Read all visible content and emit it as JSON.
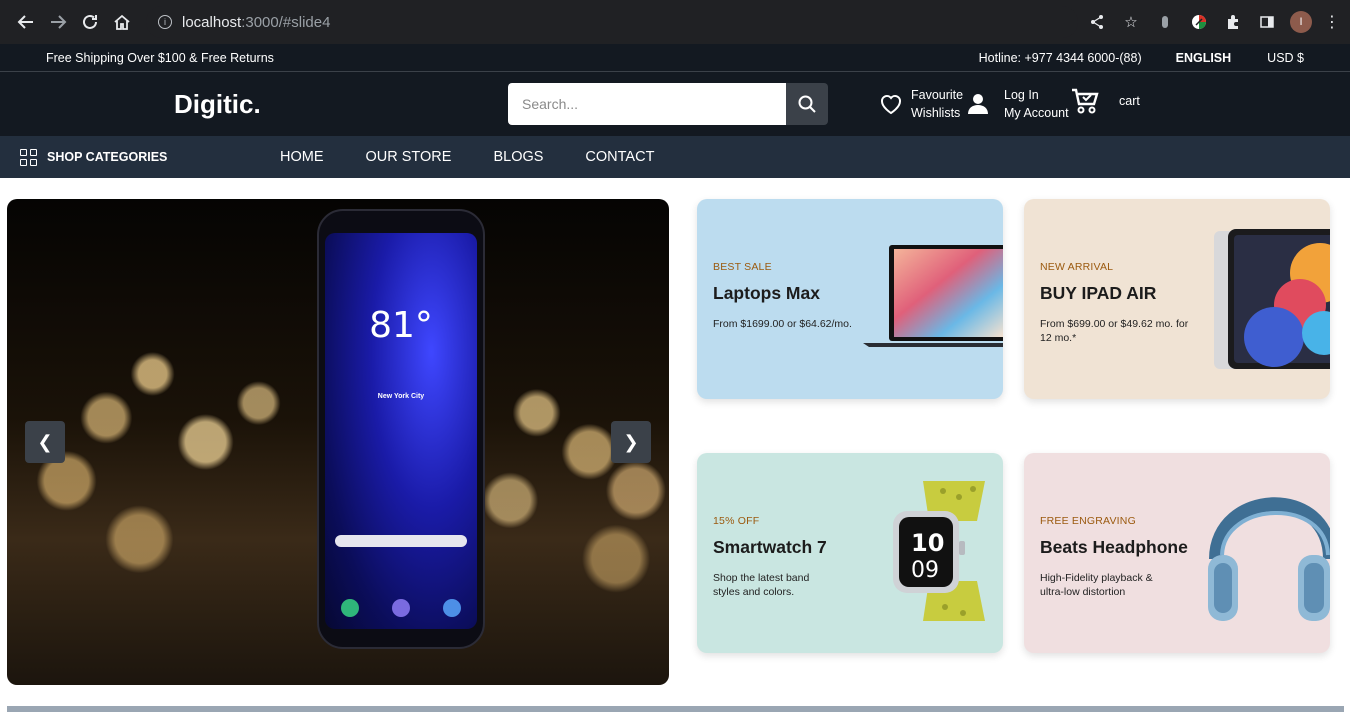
{
  "browser": {
    "url_host": "localhost",
    "url_path": ":3000/#slide4",
    "avatar_letter": "I"
  },
  "top_strip": {
    "shipping": "Free Shipping Over $100 & Free Returns",
    "hotline": "Hotline: +977 4344 6000-(88)",
    "language": "ENGLISH",
    "currency": "USD $"
  },
  "header": {
    "logo": "Digitic.",
    "search_placeholder": "Search...",
    "favourite_line1": "Favourite",
    "favourite_line2": "Wishlists",
    "login_line1": "Log In",
    "login_line2": "My Account",
    "cart_label": "cart"
  },
  "nav": {
    "shop_categories": "SHOP CATEGORIES",
    "items": [
      "HOME",
      "OUR STORE",
      "BLOGS",
      "CONTACT"
    ]
  },
  "hero": {
    "phone_time": "81°",
    "phone_city": "New York City",
    "prev_label": "❮",
    "next_label": "❯"
  },
  "cards": [
    {
      "tag": "BEST SALE",
      "title": "Laptops Max",
      "desc": "From $1699.00 or $64.62/mo.",
      "bg": "#bcdcef"
    },
    {
      "tag": "NEW ARRIVAL",
      "title": "BUY IPAD AIR",
      "desc": "From $699.00 or $49.62 mo. for 12 mo.*",
      "bg": "#f0e3d4"
    },
    {
      "tag": "15% OFF",
      "title": "Smartwatch 7",
      "desc": "Shop the latest band styles and colors.",
      "bg": "#c9e6e1"
    },
    {
      "tag": "FREE ENGRAVING",
      "title": "Beats Headphone",
      "desc": "High-Fidelity playback & ultra-low distortion",
      "bg": "#f0dfe0"
    }
  ],
  "icons": {
    "back": "arrow-left-icon",
    "forward": "arrow-right-icon",
    "reload": "reload-icon",
    "home": "home-icon",
    "share": "share-icon",
    "star": "star-icon",
    "extensions": "puzzle-icon",
    "sidebar": "sidebar-icon",
    "search": "search-icon",
    "heart": "heart-icon",
    "user": "user-icon",
    "cart": "cart-icon",
    "grid": "grid-icon"
  }
}
